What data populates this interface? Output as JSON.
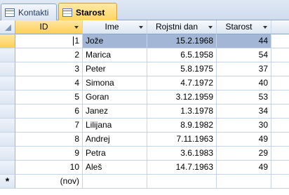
{
  "tabs": [
    {
      "label": "Kontakti",
      "icon": "table-icon",
      "active": false
    },
    {
      "label": "Starost",
      "icon": "query-icon",
      "active": true
    }
  ],
  "columns": {
    "id": "ID",
    "ime": "Ime",
    "rojstni_dan": "Rojstni dan",
    "starost": "Starost"
  },
  "rows": [
    {
      "id": "1",
      "ime": "Jože",
      "rojstni_dan": "15.2.1968",
      "starost": "44"
    },
    {
      "id": "2",
      "ime": "Marica",
      "rojstni_dan": "6.5.1958",
      "starost": "54"
    },
    {
      "id": "3",
      "ime": "Peter",
      "rojstni_dan": "5.8.1975",
      "starost": "37"
    },
    {
      "id": "4",
      "ime": "Simona",
      "rojstni_dan": "4.7.1972",
      "starost": "40"
    },
    {
      "id": "5",
      "ime": "Goran",
      "rojstni_dan": "3.12.1959",
      "starost": "53"
    },
    {
      "id": "6",
      "ime": "Janez",
      "rojstni_dan": "1.3.1978",
      "starost": "34"
    },
    {
      "id": "7",
      "ime": "Lilijana",
      "rojstni_dan": "8.9.1982",
      "starost": "30"
    },
    {
      "id": "8",
      "ime": "Andrej",
      "rojstni_dan": "7.11.1963",
      "starost": "49"
    },
    {
      "id": "9",
      "ime": "Petra",
      "rojstni_dan": "3.6.1983",
      "starost": "29"
    },
    {
      "id": "10",
      "ime": "Aleš",
      "rojstni_dan": "14.7.1963",
      "starost": "49"
    }
  ],
  "new_row": {
    "marker": "*",
    "id_placeholder": "(nov)"
  },
  "colors": {
    "selected_row": "#a4b6d6",
    "active_header": "#ffcf57",
    "grid_line": "#c5d4e6"
  }
}
